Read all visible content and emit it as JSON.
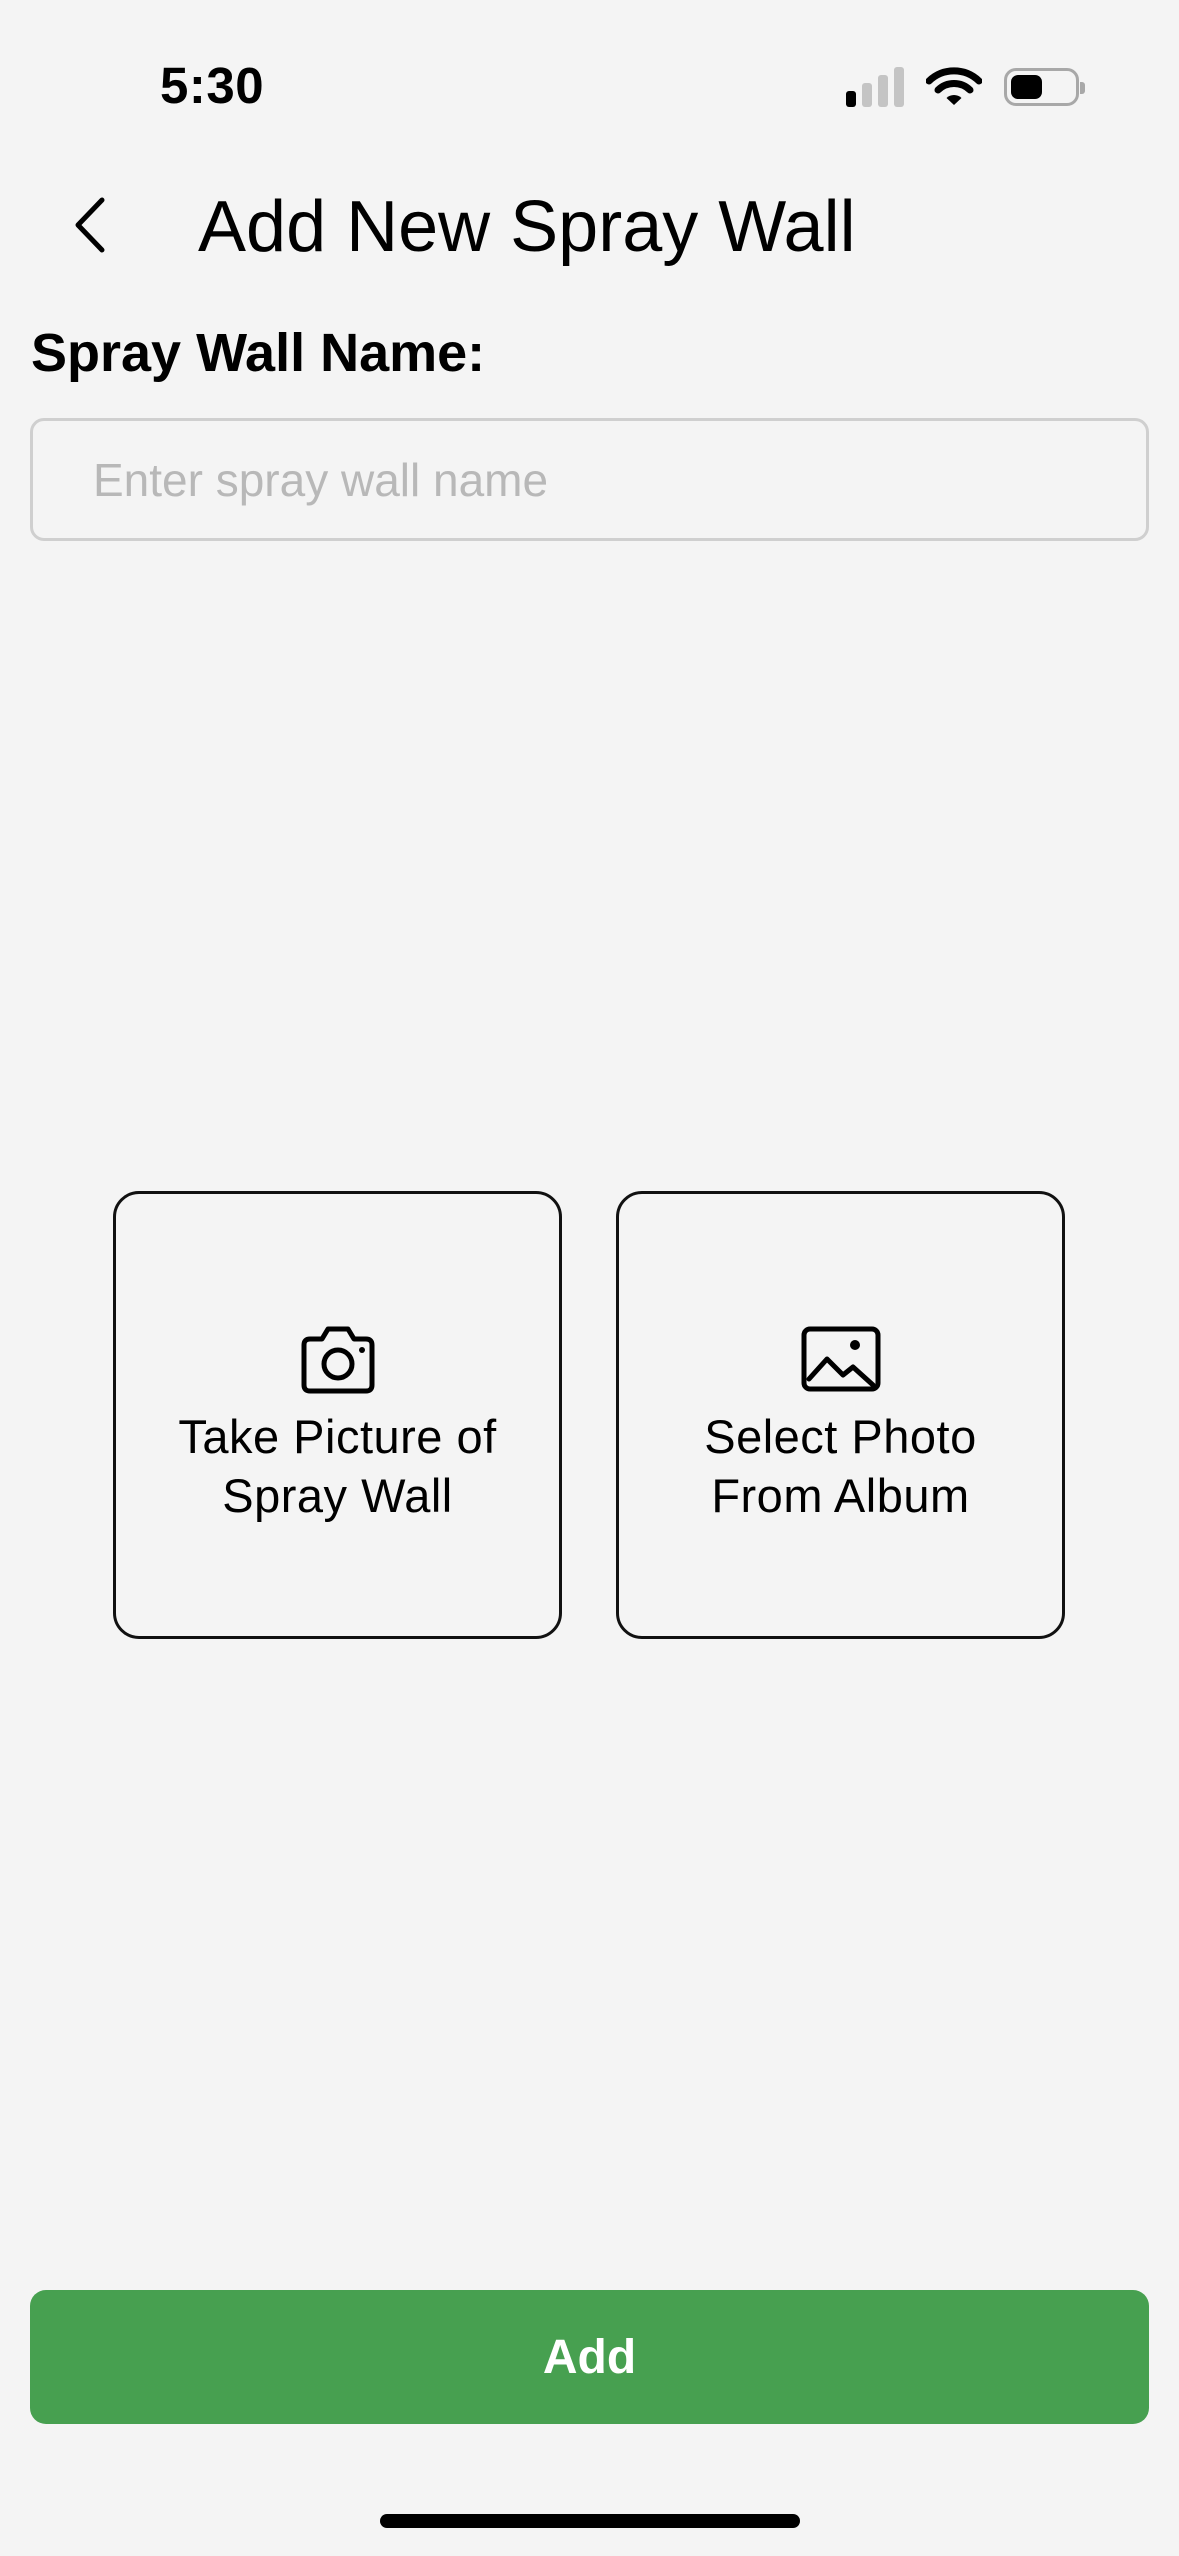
{
  "status_bar": {
    "time": "5:30",
    "signal_bars_active": 1,
    "signal_bars_total": 4,
    "battery_level": 0.5
  },
  "header": {
    "back_icon": "chevron-left-icon",
    "title": "Add New Spray Wall"
  },
  "form": {
    "name_label": "Spray Wall Name:",
    "name_value": "",
    "name_placeholder": "Enter spray wall name"
  },
  "options": [
    {
      "icon": "camera-icon",
      "label": "Take Picture of\nSpray Wall"
    },
    {
      "icon": "image-icon",
      "label": "Select Photo\nFrom Album"
    }
  ],
  "actions": {
    "add_label": "Add"
  },
  "colors": {
    "background": "#f4f4f4",
    "accent": "#47a050",
    "input_border": "#cfcfcf",
    "placeholder": "#b8b8b8"
  }
}
